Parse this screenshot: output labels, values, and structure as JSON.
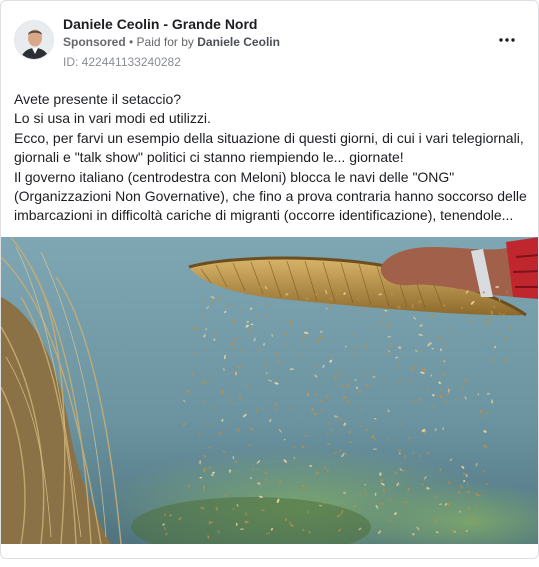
{
  "ad": {
    "page_name": "Daniele Ceolin - Grande Nord",
    "sponsored_label": "Sponsored",
    "separator": " • ",
    "paid_for_prefix": "Paid for by ",
    "paid_for_name": "Daniele Ceolin",
    "ad_id": "ID: 422441133240282",
    "more_icon": "more-horizontal-icon"
  },
  "post": {
    "lines": [
      "Avete presente il setaccio?",
      "Lo si usa in vari modi ed utilizzi.",
      "Ecco, per farvi un esempio della situazione di questi giorni, di cui i vari telegiornali,",
      "giornali e \"talk show\" politici ci stanno riempiendo le... giornate!",
      "Il governo italiano (centrodestra con Meloni) blocca le navi delle \"ONG\"",
      "(Organizzazioni Non Governative), che fino a prova contraria hanno soccorso delle",
      "imbarcazioni in difficoltà cariche di migranti (occorre identificazione), tenendole..."
    ]
  },
  "colors": {
    "text_primary": "#1c1e21",
    "text_secondary": "#65676b",
    "border": "#dddfe2",
    "sky": "#6f9aa8",
    "basket": "#b58a3e",
    "straw": "#b9a06a"
  }
}
